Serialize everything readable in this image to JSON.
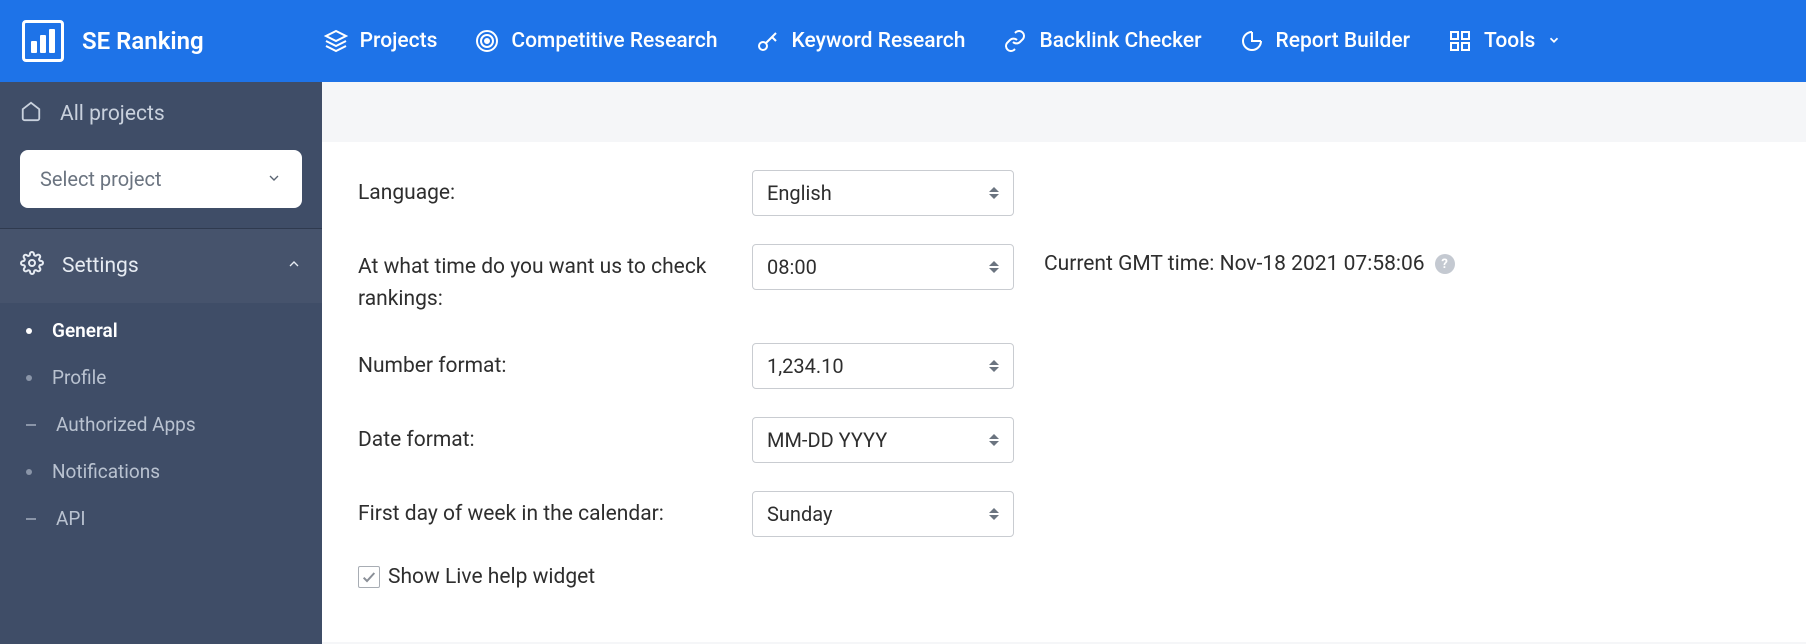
{
  "brand": "SE Ranking",
  "nav": {
    "projects": "Projects",
    "competitive": "Competitive Research",
    "keyword": "Keyword Research",
    "backlink": "Backlink Checker",
    "report": "Report Builder",
    "tools": "Tools"
  },
  "sidebar": {
    "all_projects": "All projects",
    "select_project": "Select project",
    "settings": "Settings",
    "items": {
      "general": "General",
      "profile": "Profile",
      "authorized_apps": "Authorized Apps",
      "notifications": "Notifications",
      "api": "API"
    }
  },
  "form": {
    "language_label": "Language:",
    "language_value": "English",
    "check_time_label": "At what time do you want us to check rankings:",
    "check_time_value": "08:00",
    "gmt_text": "Current GMT time: Nov-18 2021 07:58:06",
    "number_format_label": "Number format:",
    "number_format_value": "1,234.10",
    "date_format_label": "Date format:",
    "date_format_value": "MM-DD YYYY",
    "first_day_label": "First day of week in the calendar:",
    "first_day_value": "Sunday",
    "show_live_help": "Show Live help widget"
  }
}
